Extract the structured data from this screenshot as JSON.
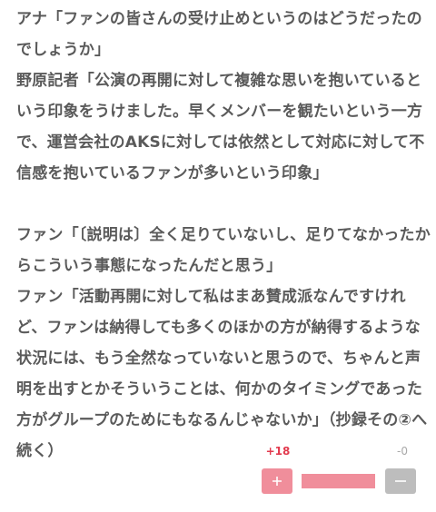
{
  "article": {
    "paragraphs": [
      "アナ「ファンの皆さんの受け止めというのはどうだったのでしょうか」",
      "野原記者「公演の再開に対して複雑な思いを抱いているという印象をうけました。早くメンバーを観たいという一方で、運営会社のAKSに対しては依然として対応に対して不信感を抱いているファンが多いという印象」",
      "ファン「〔説明は〕全く足りていないし、足りてなかったからこういう事態になったんだと思う」",
      "ファン「活動再開に対して私はまあ賛成派なんですけれど、ファンは納得しても多くのほかの方が納得するような状況には、もう全然なっていないと思うので、ちゃんと声明を出すとかそういうことは、何かのタイミングであった方がグループのためにもなるんじゃないか」（抄録その②へ続く）"
    ]
  },
  "vote": {
    "plus_count": "+18",
    "minus_count": "-0",
    "plus_label": "+",
    "minus_label": "−",
    "ratio": 1.0,
    "colors": {
      "plus": "#f08e9b",
      "minus": "#bdbdbd",
      "plus_text": "#e23a4e"
    }
  }
}
